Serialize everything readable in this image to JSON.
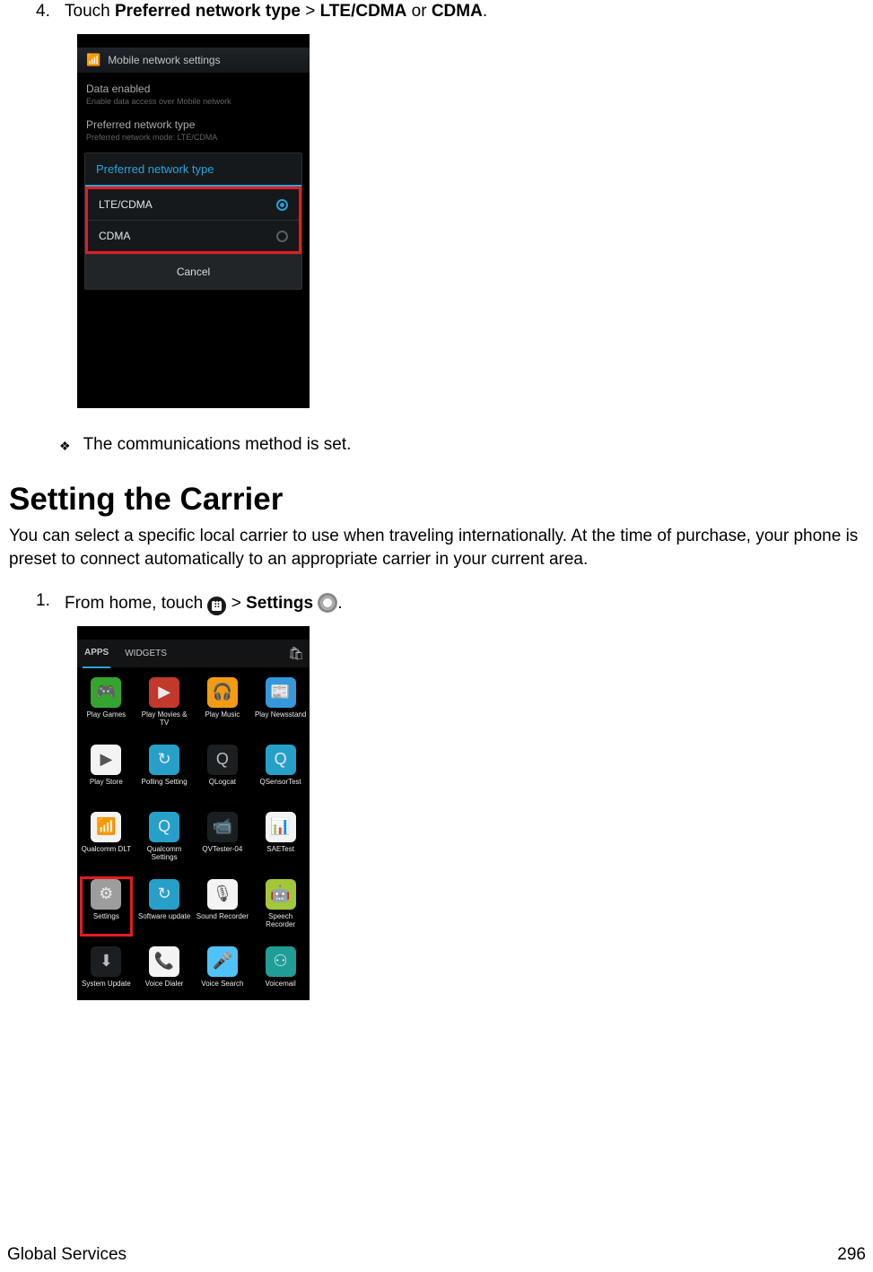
{
  "step4": {
    "num": "4.",
    "pre": "Touch ",
    "bold1": "Preferred network type",
    "sep1": " > ",
    "bold2": "LTE/CDMA",
    "sep2": " or ",
    "bold3": "CDMA",
    "end": "."
  },
  "screenshot1": {
    "title": "Mobile network settings",
    "dataEnabledTitle": "Data enabled",
    "dataEnabledSub": "Enable data access over Mobile network",
    "prefTitle": "Preferred network type",
    "prefSub": "Preferred network mode: LTE/CDMA",
    "dialogTitle": "Preferred network type",
    "opt1": "LTE/CDMA",
    "opt2": "CDMA",
    "cancel": "Cancel"
  },
  "result": "The communications method is set.",
  "heading": "Setting the Carrier",
  "paragraph": "You can select a specific local carrier to use when traveling internationally. At the time of purchase, your phone is preset to connect automatically to an appropriate carrier in your current area.",
  "step1": {
    "num": "1.",
    "pre": "From home, touch ",
    "sep": " > ",
    "bold": "Settings",
    "end": "."
  },
  "screenshot2": {
    "tabApps": "APPS",
    "tabWidgets": "WIDGETS",
    "apps": [
      {
        "label": "Play Games",
        "cls": "green",
        "glyph": "🎮"
      },
      {
        "label": "Play Movies & TV",
        "cls": "red",
        "glyph": "▶"
      },
      {
        "label": "Play Music",
        "cls": "orange",
        "glyph": "🎧"
      },
      {
        "label": "Play Newsstand",
        "cls": "blue",
        "glyph": "📰"
      },
      {
        "label": "Play Store",
        "cls": "white",
        "glyph": "▶"
      },
      {
        "label": "Polling Setting",
        "cls": "cyan",
        "glyph": "↻"
      },
      {
        "label": "QLogcat",
        "cls": "black",
        "glyph": "Q"
      },
      {
        "label": "QSensorTest",
        "cls": "cyan",
        "glyph": "Q"
      },
      {
        "label": "Qualcomm DLT",
        "cls": "white",
        "glyph": "📶"
      },
      {
        "label": "Qualcomm Settings",
        "cls": "cyan",
        "glyph": "Q"
      },
      {
        "label": "QVTester-04",
        "cls": "black",
        "glyph": "📹"
      },
      {
        "label": "SAETest",
        "cls": "white",
        "glyph": "📊"
      },
      {
        "label": "Settings",
        "cls": "gray",
        "glyph": "⚙"
      },
      {
        "label": "Software update",
        "cls": "cyan",
        "glyph": "↻"
      },
      {
        "label": "Sound Recorder",
        "cls": "white",
        "glyph": "🎙"
      },
      {
        "label": "Speech Recorder",
        "cls": "droidg",
        "glyph": "🤖"
      },
      {
        "label": "System Update",
        "cls": "black",
        "glyph": "⬇"
      },
      {
        "label": "Voice Dialer",
        "cls": "white",
        "glyph": "📞"
      },
      {
        "label": "Voice Search",
        "cls": "sky",
        "glyph": "🎤"
      },
      {
        "label": "Voicemail",
        "cls": "teal",
        "glyph": "⚇"
      }
    ]
  },
  "footer": {
    "left": "Global Services",
    "right": "296"
  }
}
